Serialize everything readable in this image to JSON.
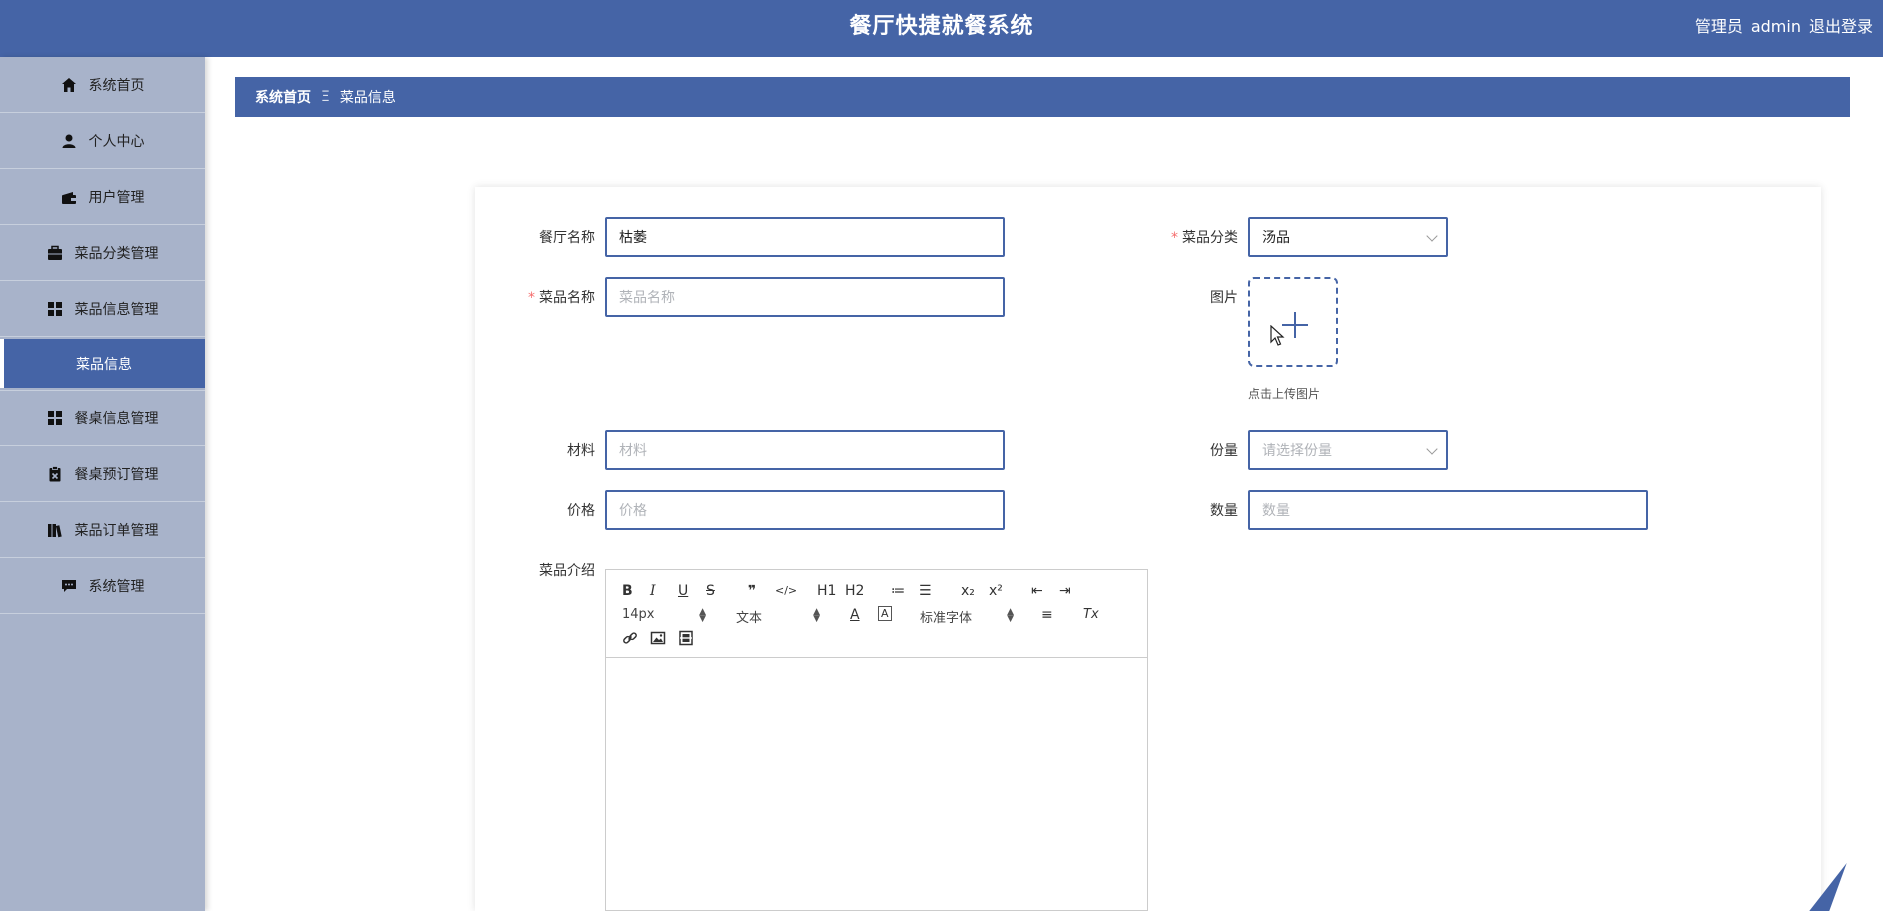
{
  "header": {
    "title": "餐厅快捷就餐系统",
    "user_role": "管理员",
    "username": "admin",
    "logout_label": "退出登录"
  },
  "sidebar": {
    "items": [
      {
        "label": "系统首页",
        "icon": "home-icon"
      },
      {
        "label": "个人中心",
        "icon": "user-icon"
      },
      {
        "label": "用户管理",
        "icon": "wallet-icon"
      },
      {
        "label": "菜品分类管理",
        "icon": "briefcase-icon"
      },
      {
        "label": "菜品信息管理",
        "icon": "grid-icon"
      },
      {
        "label": "菜品信息",
        "icon": ""
      },
      {
        "label": "餐桌信息管理",
        "icon": "grid-icon"
      },
      {
        "label": "餐桌预订管理",
        "icon": "clipboard-icon"
      },
      {
        "label": "菜品订单管理",
        "icon": "books-icon"
      },
      {
        "label": "系统管理",
        "icon": "chat-icon"
      }
    ]
  },
  "breadcrumb": {
    "home": "系统首页",
    "separator": "Ξ",
    "current": "菜品信息"
  },
  "form": {
    "restaurant_name_label": "餐厅名称",
    "restaurant_name_value": "枯萎",
    "category_label": "菜品分类",
    "category_value": "汤品",
    "dish_name_label": "菜品名称",
    "dish_name_placeholder": "菜品名称",
    "image_label": "图片",
    "upload_tip": "点击上传图片",
    "material_label": "材料",
    "material_placeholder": "材料",
    "portion_label": "份量",
    "portion_placeholder": "请选择份量",
    "price_label": "价格",
    "price_placeholder": "价格",
    "quantity_label": "数量",
    "quantity_placeholder": "数量",
    "intro_label": "菜品介绍",
    "required_mark": "*"
  },
  "editor": {
    "font_size": "14px",
    "heading": "文本",
    "font_family": "标准字体",
    "buttons": [
      "B",
      "I",
      "U",
      "S",
      "❞",
      "</>",
      "H1",
      "H2",
      "≔",
      "☰",
      "x₂",
      "x²",
      "⇤",
      "⇥",
      "A",
      "A",
      "≡",
      "Tx"
    ]
  },
  "colors": {
    "primary": "#4564a6",
    "sidebar_bg": "#a8b3ca",
    "required": "#f56c6c"
  }
}
